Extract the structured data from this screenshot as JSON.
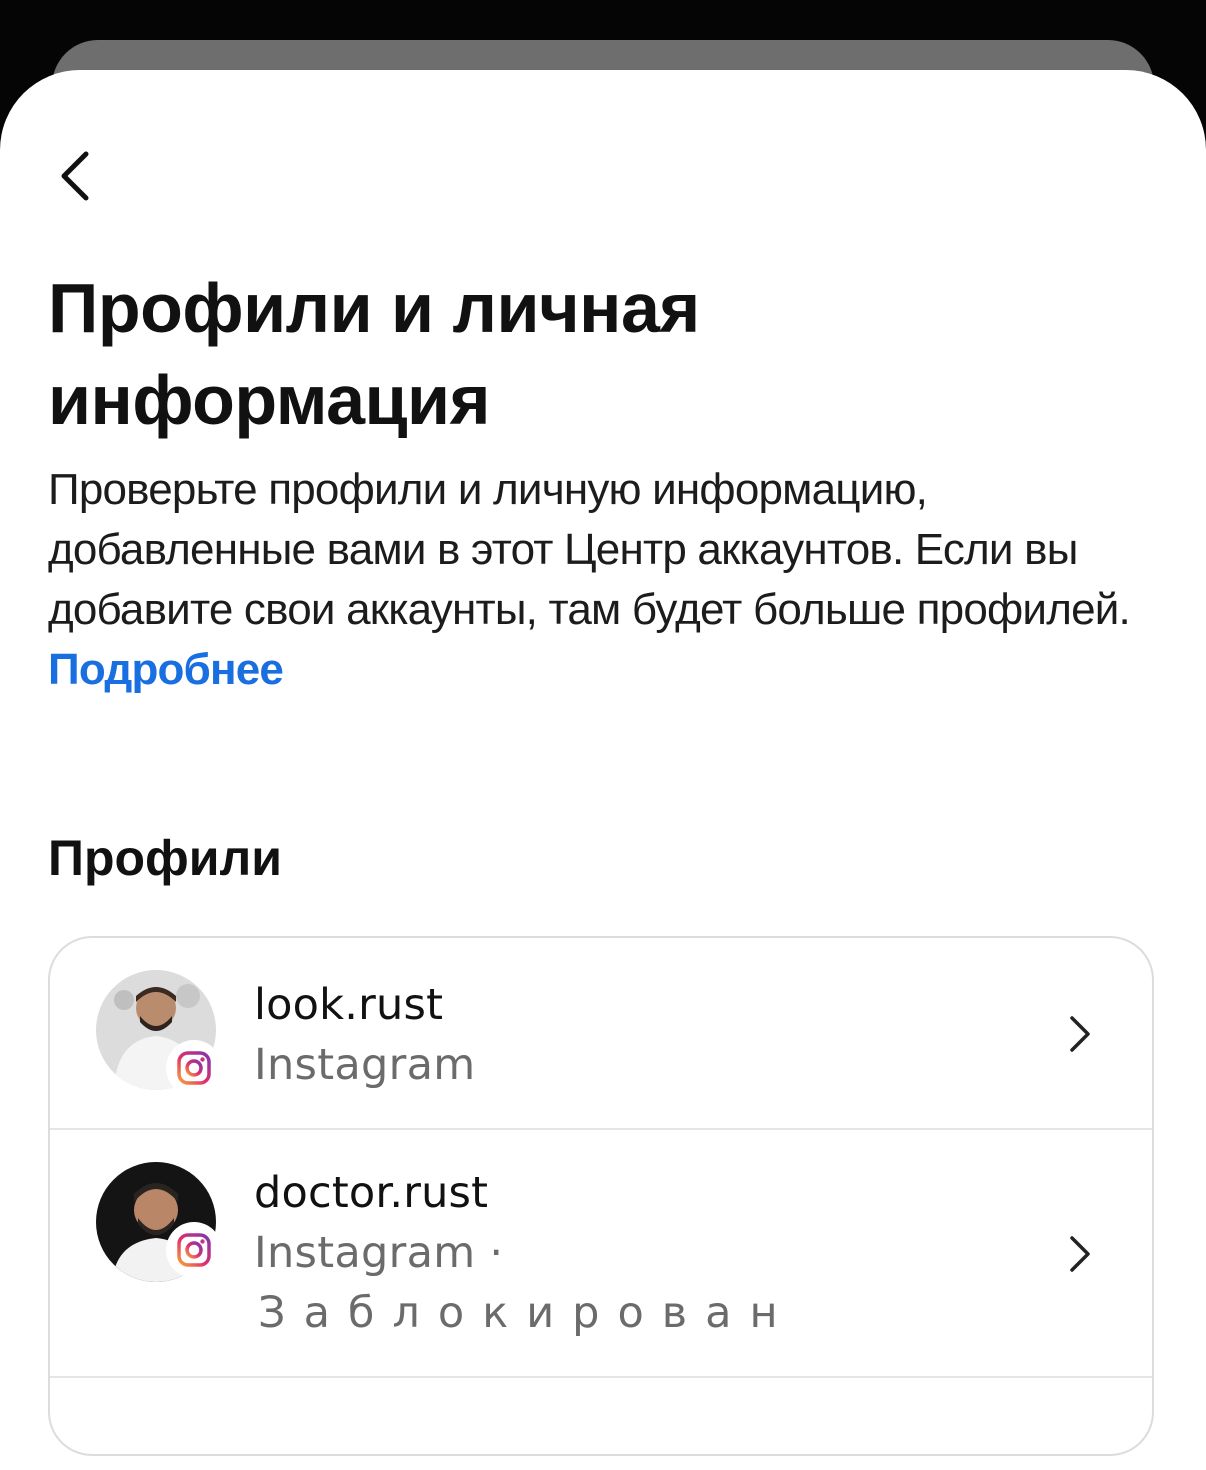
{
  "header": {
    "title": "Профили и личная информация",
    "description": "Проверьте профили и личную информацию, добавленные вами в этот Центр аккаунтов. Если вы добавите свои аккаунты, там будет больше профилей.",
    "learn_more_link": "Подробнее"
  },
  "profiles_section": {
    "heading": "Профили",
    "items": [
      {
        "username": "look.rust",
        "platform": "Instagram",
        "avatar": "profile-photo-light-background",
        "badge_icon": "instagram-icon"
      },
      {
        "username": "doctor.rust",
        "platform": "Instagram ·",
        "status": "Заблокирован",
        "avatar": "profile-photo-dark-background",
        "badge_icon": "instagram-icon"
      }
    ]
  },
  "colors": {
    "link": "#1a6fe0",
    "text_primary": "#111111",
    "text_secondary": "#6b6b6b",
    "card_border": "#dcdcdc"
  },
  "icons": {
    "back": "chevron-left-icon",
    "row_arrow": "chevron-right-icon"
  }
}
